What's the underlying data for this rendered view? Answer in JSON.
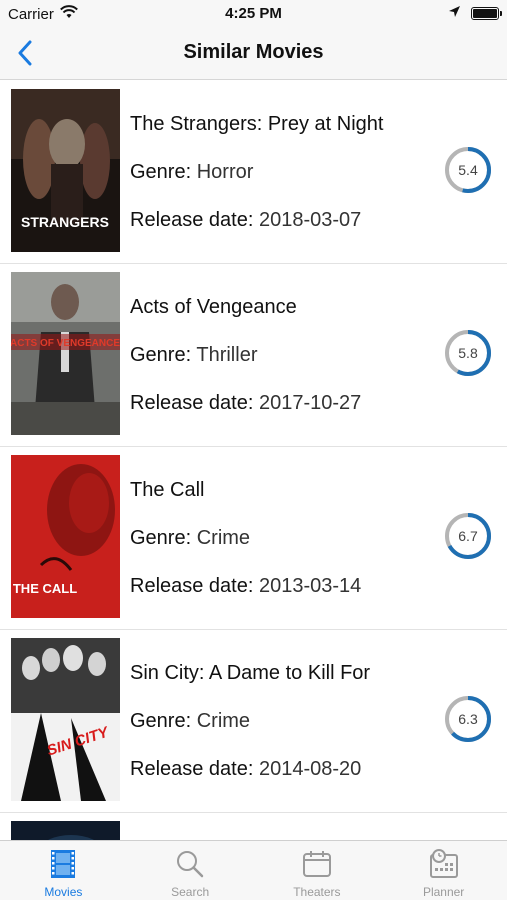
{
  "status_bar": {
    "carrier": "Carrier",
    "time": "4:25 PM"
  },
  "nav": {
    "title": "Similar Movies",
    "back_icon": "chevron-left-icon"
  },
  "movies": [
    {
      "title": "The Strangers: Prey at Night",
      "genre_label": "Genre:",
      "genre": "Horror",
      "release_label": "Release date:",
      "release": "2018-03-07",
      "rating": "5.4",
      "rating_fraction": 0.54,
      "poster_text": "STRANGERS"
    },
    {
      "title": "Acts of Vengeance",
      "genre_label": "Genre:",
      "genre": "Thriller",
      "release_label": "Release date:",
      "release": "2017-10-27",
      "rating": "5.8",
      "rating_fraction": 0.58,
      "poster_text": "ACTS OF VENGEANCE"
    },
    {
      "title": "The Call",
      "genre_label": "Genre:",
      "genre": "Crime",
      "release_label": "Release date:",
      "release": "2013-03-14",
      "rating": "6.7",
      "rating_fraction": 0.67,
      "poster_text": "THE CALL"
    },
    {
      "title": "Sin City: A Dame to Kill For",
      "genre_label": "Genre:",
      "genre": "Crime",
      "release_label": "Release date:",
      "release": "2014-08-20",
      "rating": "6.3",
      "rating_fraction": 0.63,
      "poster_text": "SIN CITY"
    }
  ],
  "tabs": [
    {
      "label": "Movies",
      "icon": "film-icon",
      "active": true
    },
    {
      "label": "Search",
      "icon": "search-icon",
      "active": false
    },
    {
      "label": "Theaters",
      "icon": "ticket-icon",
      "active": false
    },
    {
      "label": "Planner",
      "icon": "calendar-icon",
      "active": false
    }
  ],
  "colors": {
    "accent": "#1a7be0",
    "ring": "#1f6fb2",
    "ring_track": "#b5b5b5"
  }
}
